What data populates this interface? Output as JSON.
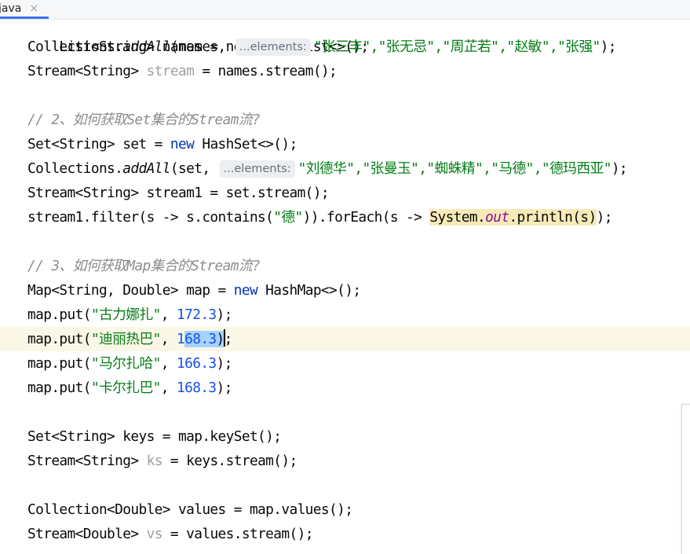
{
  "tab": {
    "label": "java",
    "close": "×"
  },
  "code": {
    "l0": {
      "text": "List<String> names = new ArrayList<>();"
    },
    "l1": {
      "a": "Collections.",
      "m": "addAll",
      "b": "(names, ",
      "hint": "...elements:",
      "s": "\"张三丰\",\"张无忌\",\"周芷若\",\"赵敏\",\"张强\"",
      "c": ");"
    },
    "l2": {
      "a": "Stream<String> ",
      "v": "stream",
      "b": " = names.stream();"
    },
    "l4": {
      "c": "// 2、如何获取Set集合的Stream流?"
    },
    "l5": {
      "a": "Set<String> set = ",
      "k": "new",
      "b": " HashSet<>();"
    },
    "l6": {
      "a": "Collections.",
      "m": "addAll",
      "b": "(set, ",
      "hint": "...elements:",
      "s": "\"刘德华\",\"张曼玉\",\"蜘蛛精\",\"马德\",\"德玛西亚\"",
      "c": ");"
    },
    "l7": {
      "a": "Stream<String> stream1 = set.stream();"
    },
    "l8": {
      "a": "stream1.filter(s -> s.contains(",
      "s": "\"德\"",
      "b": ")).forEach(s -> ",
      "h1": "System.",
      "f": "out",
      "h2": ".println(s)",
      "c": ");"
    },
    "l10": {
      "c": "// 3、如何获取Map集合的Stream流?"
    },
    "l11": {
      "a": "Map<String, Double> map = ",
      "k": "new",
      "b": " HashMap<>();"
    },
    "l12": {
      "a": "map.put(",
      "s": "\"古力娜扎\"",
      "b": ", ",
      "n": "172.3",
      "c": ");"
    },
    "l13": {
      "a": "map.put(",
      "s": "\"迪丽热巴\"",
      "b": ", ",
      "n1": "1",
      "n2": "68.3",
      "sel": ")",
      "c": ";"
    },
    "l14": {
      "a": "map.put(",
      "s": "\"马尔扎哈\"",
      "b": ", ",
      "n": "166.3",
      "c": ");"
    },
    "l15": {
      "a": "map.put(",
      "s": "\"卡尔扎巴\"",
      "b": ", ",
      "n": "168.3",
      "c": ");"
    },
    "l17": {
      "a": "Set<String> keys = map.keySet();"
    },
    "l18": {
      "a": "Stream<String> ",
      "v": "ks",
      "b": " = keys.stream();"
    },
    "l20": {
      "a": "Collection<Double> values = map.values();"
    },
    "l21": {
      "a": "Stream<Double> ",
      "v": "vs",
      "b": " = values.stream();"
    }
  },
  "colors": {
    "keyword": "#0033b3",
    "string": "#067d17",
    "number": "#1750eb",
    "comment": "#8c8c8c",
    "field": "#871094",
    "current_line": "#fbf7e6",
    "selection": "#a6d2ff",
    "highlight": "#f8eab8"
  }
}
